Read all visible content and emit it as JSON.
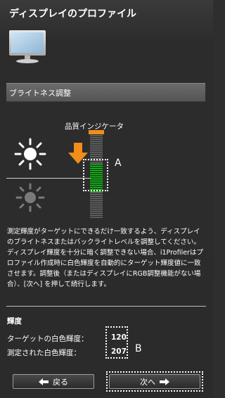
{
  "header": {
    "title": "ディスプレイのプロファイル",
    "icon": "monitor-icon"
  },
  "section": {
    "label": "ブライトネス調整"
  },
  "meter": {
    "title": "品質インジケータ",
    "marker_label": "A",
    "accent_color": "#f28c1b",
    "good_color": "#27c22a"
  },
  "icons": {
    "bright": "sun-bright-icon",
    "dim": "sun-dim-icon",
    "arrow": "arrow-down-icon"
  },
  "instructions": "測定輝度がターゲットにできるだけ一致するよう、ディスプレイのブライトネスまたはバックライトレベルを調整してください。ディスプレイ輝度を十分に暗く調整できない場合、i1Profilerはプロファイル作成時に白色輝度を自動的にターゲット輝度値に一致させます。調整後（またはディスプレイにRGB調整機能がない場合）、[次へ] を押して続行します。",
  "luminance": {
    "heading": "輝度",
    "target_label": "ターゲットの白色輝度：",
    "target_value": "120",
    "measured_label": "測定された白色輝度：",
    "measured_value": "207",
    "marker_label": "B"
  },
  "nav": {
    "back_label": "戻る",
    "next_label": "次へ"
  }
}
